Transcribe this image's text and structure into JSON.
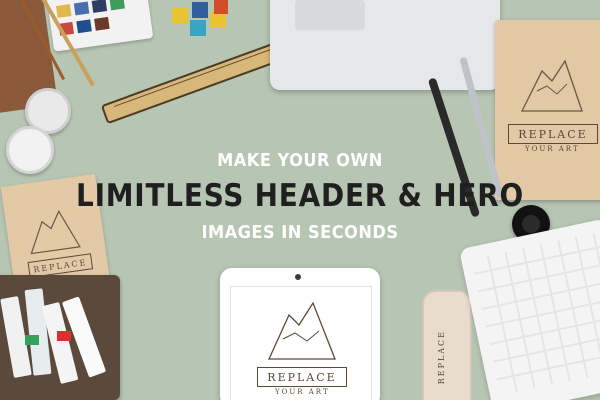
{
  "hero": {
    "line1": "MAKE YOUR OWN",
    "line2": "LIMITLESS HEADER & HERO",
    "line3": "IMAGES IN SECONDS"
  },
  "logo": {
    "word": "REPLACE",
    "sub": "YOUR ART"
  },
  "colors": {
    "background": "#b7c5b3",
    "headline_light": "#ffffff",
    "headline_dark": "#1f1f1f",
    "kraft": "#e3c9a6",
    "ink": "#5a4a38"
  }
}
